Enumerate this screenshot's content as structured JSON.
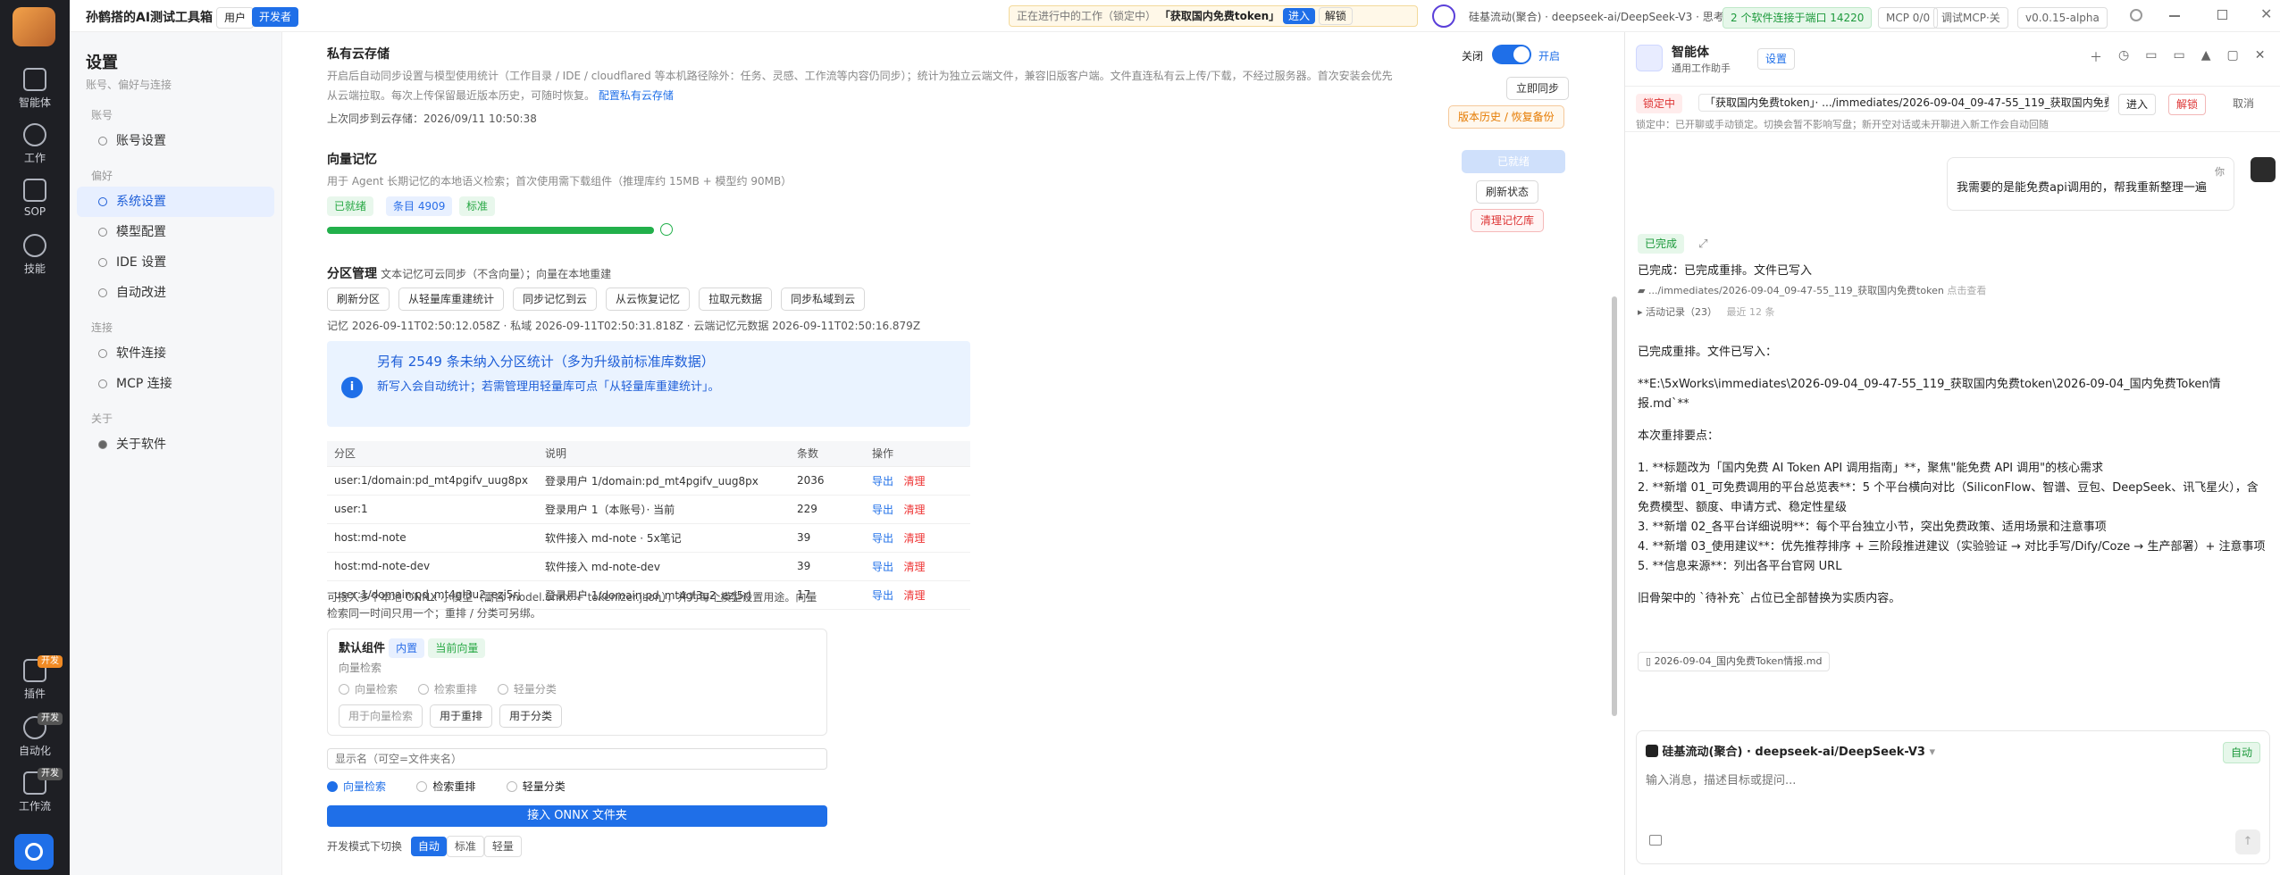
{
  "app": {
    "title": "孙鹤搭的AI测试工具箱",
    "mode_user": "用户",
    "mode_dev": "开发者"
  },
  "topbar": {
    "work_label": "正在进行中的工作（锁定中）",
    "work_name": "「获取国内免费token」",
    "enter": "进入",
    "unlock": "解锁",
    "model": "硅基流动(聚合) · deepseek-ai/DeepSeek-V3 · 思考",
    "status": "2 个软件连接于端口 14220",
    "mcp": "MCP 0/0",
    "debug": "调试MCP·关",
    "version": "v0.0.15-alpha"
  },
  "rail": [
    "智能体",
    "工作",
    "SOP",
    "技能",
    "插件",
    "自动化",
    "工作流"
  ],
  "rail_badges": {
    "plugin": "开发",
    "auto": "开发",
    "flow": "开发"
  },
  "nav": {
    "title": "设置",
    "subtitle": "账号、偏好与连接",
    "sections": [
      {
        "label": "账号",
        "items": [
          "账号设置"
        ]
      },
      {
        "label": "偏好",
        "items": [
          "系统设置",
          "模型配置",
          "IDE 设置",
          "自动改进"
        ]
      },
      {
        "label": "连接",
        "items": [
          "软件连接",
          "MCP 连接"
        ]
      },
      {
        "label": "关于",
        "items": [
          "关于软件"
        ]
      }
    ]
  },
  "cloud": {
    "title": "私有云存储",
    "desc1": "开启后自动同步设置与模型使用统计（工作目录 / IDE / cloudflared 等本机路径除外：任务、灵感、工作流等内容仍同步）；统计为独立云端文件，兼容旧版客户端。文件直连私有云上传/下载，不经过服务器。首次安装会优先",
    "desc2": "从云端拉取。每次上传保留最近版本历史，可随时恢复。",
    "link": "配置私有云存储",
    "last": "上次同步到云存储：2026/09/11 10:50:38",
    "toggle_off": "关闭",
    "toggle_on": "开启",
    "sync_now": "立即同步",
    "history": "版本历史 / 恢复备份"
  },
  "vector": {
    "title": "向量记忆",
    "desc": "用于 Agent 长期记忆的本地语义检索；首次使用需下载组件（推理库约 15MB + 模型约 90MB）",
    "tags": [
      "已就绪",
      "条目 4909",
      "标准"
    ],
    "progress": 1,
    "btn_ready": "已就绪",
    "btn_refresh": "刷新状态",
    "btn_clear": "清理记忆库"
  },
  "partition": {
    "title": "分区管理",
    "hint": "文本记忆可云同步（不含向量）；向量在本地重建",
    "buttons": [
      "刷新分区",
      "从轻量库重建统计",
      "同步记忆到云",
      "从云恢复记忆",
      "拉取元数据",
      "同步私域到云"
    ],
    "memo": "记忆 2026-09-11T02:50:12.058Z · 私域 2026-09-11T02:50:31.818Z · 云端记忆元数据 2026-09-11T02:50:16.879Z",
    "info_title": "另有 2549 条未纳入分区统计（多为升级前标准库数据）",
    "info_sub": "新写入会自动统计；若需管理用轻量库可点「从轻量库重建统计」。",
    "cols": [
      "分区",
      "说明",
      "条数",
      "操作"
    ],
    "rows": [
      [
        "user:1/domain:pd_mt4pgifv_uug8px",
        "登录用户 1/domain:pd_mt4pgifv_uug8px",
        "2036"
      ],
      [
        "user:1",
        "登录用户 1（本账号）· 当前",
        "229"
      ],
      [
        "host:md-note",
        "软件接入 md-note · 5x笔记",
        "39"
      ],
      [
        "host:md-note-dev",
        "软件接入 md-note-dev",
        "39"
      ],
      [
        "user:1/domain:pd_mt4gl3u2_ezj5rj",
        "登录用户 1/domain:pd_mt4gl3u2_ezj5rj",
        "17"
      ]
    ],
    "export": "导出",
    "clear": "清理"
  },
  "onnx": {
    "desc": "可接入多个本地 ONNX 小模型（需含 model.onnx + tokenizer.json），并为每个模型设置用途。向量检索同一时间只用一个；重排 / 分类可另绑。",
    "default_title": "默认组件",
    "tag_builtin": "内置",
    "tag_current": "当前向量",
    "sub": "向量检索",
    "opts": [
      "向量检索",
      "检索重排",
      "轻量分类"
    ],
    "use_btns": [
      "用于向量检索",
      "用于重排",
      "用于分类"
    ],
    "name_ph": "显示名（可空=文件夹名）",
    "connect": "接入 ONNX 文件夹",
    "mode_label": "开发模式下切换",
    "modes": [
      "自动",
      "标准",
      "轻量"
    ]
  },
  "chat": {
    "agent": "智能体",
    "agent_sub": "通用工作助手",
    "settings": "设置",
    "lock_tag": "锁定中",
    "lock_path": "「获取国内免费token」· .../immediates/2026-09-04_09-47-55_119_获取国内免费...",
    "enter": "进入",
    "unlock": "解锁",
    "cancel": "取消",
    "lock_note": "锁定中：已开聊或手动锁定。切换会暂不影响写盘；新开空对话或未开聊进入新工作会自动回随",
    "user_label": "你",
    "user_msg": "我需要的是能免费api调用的，帮我重新整理一遍",
    "done_tag": "已完成",
    "done_line": "已完成：已完成重排。文件已写入",
    "file_path": ".../immediates/2026-09-04_09-47-55_119_获取国内免费token",
    "file_hint": "点击查看",
    "activity": "活动记录（23）",
    "activity_time": "最近 12 条",
    "reply": [
      "已完成重排。文件已写入：",
      "**E:\\5xWorks\\immediates\\2026-09-04_09-47-55_119_获取国内免费token\\2026-09-04_国内免费Token情报.md`**",
      "本次重排要点：",
      "1. **标题改为「国内免费 AI Token API 调用指南」**，聚焦\"能免费 API 调用\"的核心需求",
      "2. **新增 01_可免费调用的平台总览表**：5 个平台横向对比（SiliconFlow、智谱、豆包、DeepSeek、讯飞星火），含免费模型、额度、申请方式、稳定性星级",
      "3. **新增 02_各平台详细说明**：每个平台独立小节，突出免费政策、适用场景和注意事项",
      "4. **新增 03_使用建议**：优先推荐排序 + 三阶段推进建议（实验验证 → 对比手写/Dify/Coze → 生产部署）+ 注意事项",
      "5. **信息来源**：列出各平台官网 URL",
      "旧骨架中的 `待补充` 占位已全部替换为实质内容。"
    ],
    "file_chip": "2026-09-04_国内免费Token情报.md",
    "composer_model": "硅基流动(聚合) · deepseek-ai/DeepSeek-V3",
    "composer_mode": "自动",
    "composer_ph": "输入消息，描述目标或提问..."
  }
}
